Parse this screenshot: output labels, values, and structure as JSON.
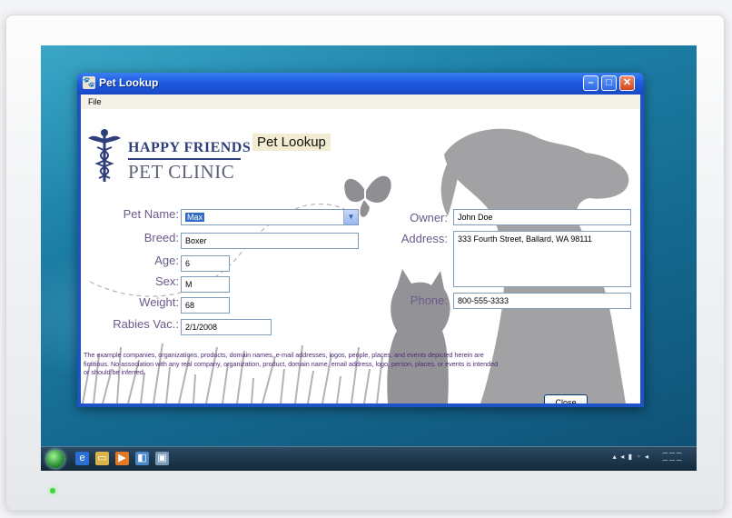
{
  "window": {
    "title": "Pet Lookup"
  },
  "menu": {
    "file_label": "File"
  },
  "logo": {
    "line1": "HAPPY FRIENDS",
    "line2": "PET CLINIC"
  },
  "form": {
    "heading": "Pet Lookup",
    "pet_name_label": "Pet Name:",
    "pet_name_value": "Max",
    "breed_label": "Breed:",
    "breed_value": "Boxer",
    "age_label": "Age:",
    "age_value": "6",
    "sex_label": "Sex:",
    "sex_value": "M",
    "weight_label": "Weight:",
    "weight_value": "68",
    "rabies_label": "Rabies Vac.:",
    "rabies_value": "2/1/2008",
    "owner_label": "Owner:",
    "owner_value": "John Doe",
    "address_label": "Address:",
    "address_value": "333 Fourth Street, Ballard, WA  98111",
    "phone_label": "Phone:",
    "phone_value": "800-555-3333",
    "close_label": "Close"
  },
  "disclaimer": "The example companies, organizations, products, domain names, e-mail addresses, logos, people, places, and events depicted herein are fictitious. No association with any real company, organization, product, domain name, email address, logo, person, places, or events is intended or should be inferred.",
  "taskbar": {
    "icons": [
      "start-orb",
      "ie-icon",
      "folder-icon",
      "media-icon",
      "explorer-icon",
      "app-icon"
    ]
  },
  "colors": {
    "titlebar": "#1e5be0",
    "label_text": "#6b5a8a",
    "disclaimer_text": "#4a2a78",
    "silhouette": "#9e9ea0"
  }
}
